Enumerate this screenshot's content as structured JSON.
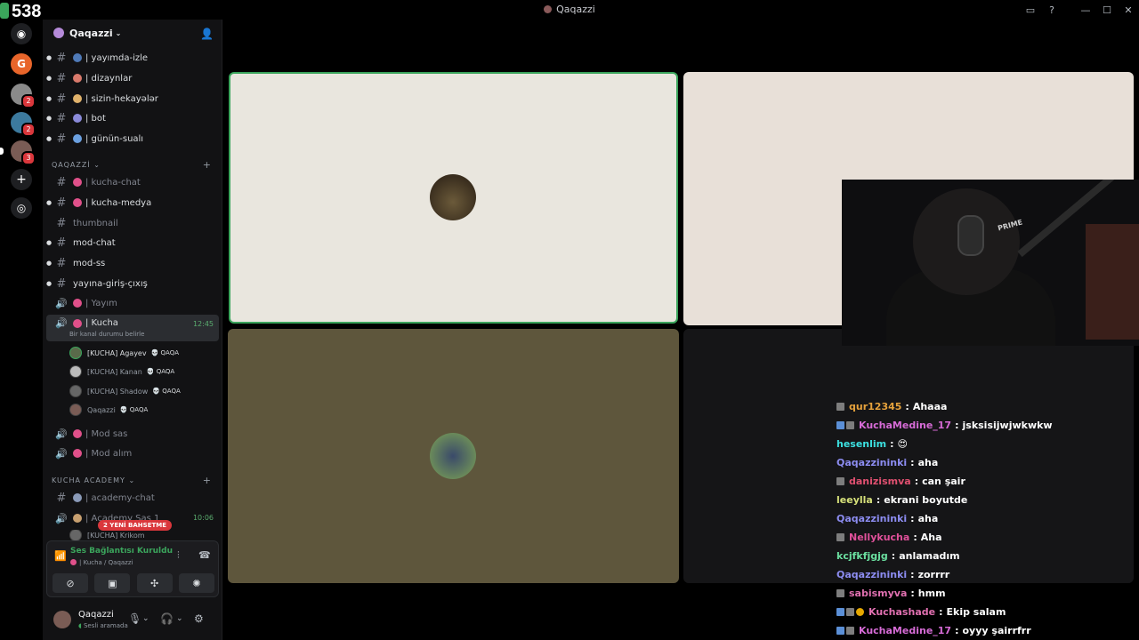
{
  "window": {
    "title": "Qaqazzi",
    "counter": "538"
  },
  "server": {
    "name": "Qaqazzi"
  },
  "channels": [
    {
      "id": "yayimda-izle",
      "label": "| yayımda-izle",
      "emoji_color": "#4f7ab8"
    },
    {
      "id": "dizaynlar",
      "label": "| dizaynlar",
      "emoji_color": "#d97a6c"
    },
    {
      "id": "sizin-hekayeler",
      "label": "| sizin-hekayələr",
      "emoji_color": "#e0b26b"
    },
    {
      "id": "bot",
      "label": "| bot",
      "emoji_color": "#8a8ad9"
    },
    {
      "id": "gunun-suali",
      "label": "| günün-sualı",
      "emoji_color": "#6ba0e0"
    }
  ],
  "category1": {
    "label": "QAQAZZİ"
  },
  "channels2": [
    {
      "id": "kucha-chat",
      "label": "| kucha-chat",
      "muted": true
    },
    {
      "id": "kucha-medya",
      "label": "| kucha-medya",
      "muted": false
    },
    {
      "id": "thumbnail",
      "label": "thumbnail",
      "muted": true
    },
    {
      "id": "mod-chat",
      "label": "mod-chat",
      "muted": false
    },
    {
      "id": "mod-ss",
      "label": "mod-ss",
      "muted": false
    },
    {
      "id": "yayina-giris-cixis",
      "label": "yayına-giriş-çıxış",
      "muted": false
    }
  ],
  "voice": {
    "yayim": "| Yayım",
    "kucha": {
      "label": "| Kucha",
      "time": "12:45",
      "status": "Bir kanal durumu belirle"
    },
    "users": [
      {
        "name": "[KUCHA] Agayev",
        "tag": "QAQA",
        "dim": false
      },
      {
        "name": "[KUCHA] Kanan",
        "tag": "QAQA",
        "dim": true
      },
      {
        "name": "[KUCHA] Shadow",
        "tag": "QAQA",
        "dim": true
      },
      {
        "name": "Qaqazzi",
        "tag": "QAQA",
        "dim": true
      }
    ],
    "mod_sas": "| Mod sas",
    "mod_alim": "| Mod alım"
  },
  "category2": {
    "label": "KUCHA ACADEMY"
  },
  "academy": {
    "chat": "| academy-chat",
    "sas": "| Academy Sas 1",
    "sas_time": "10:06",
    "partial_user": "[KUCHA] Krikom"
  },
  "mention_badge": "2 YENİ BAHSETME",
  "voice_panel": {
    "status": "Ses Bağlantısı Kuruldu",
    "location": "| Kucha / Qaqazzi"
  },
  "user": {
    "name": "Qaqazzi",
    "status": "Sesli aramada"
  },
  "colors": {
    "tile1": "#e9e6de",
    "tile2": "#e8e0d8",
    "tile3": "#5e563c",
    "tile4": "#151517",
    "speaking_border": "#3ba55c",
    "online_green": "#3ba55c"
  },
  "chat": [
    {
      "user": "qur12345",
      "color": "#e6a23c",
      "text": "Ahaaa",
      "badges": [
        "gray"
      ]
    },
    {
      "user": "KuchaMedine_17",
      "color": "#d66bd6",
      "text": "jsksisijwjwkwkw",
      "badges": [
        "blue",
        "gray"
      ]
    },
    {
      "user": "hesenlim",
      "color": "#3ce0e0",
      "text": "😍",
      "badges": []
    },
    {
      "user": "Qaqazzininki",
      "color": "#8c8cf0",
      "text": "aha",
      "badges": []
    },
    {
      "user": "danizismva",
      "color": "#e05070",
      "text": "can şair",
      "badges": [
        "gray"
      ]
    },
    {
      "user": "leeylla",
      "color": "#d6e07a",
      "text": "ekrani boyutde",
      "badges": []
    },
    {
      "user": "Qaqazzininki",
      "color": "#8c8cf0",
      "text": "aha",
      "badges": []
    },
    {
      "user": "Nellykucha",
      "color": "#e0509a",
      "text": "Aha",
      "badges": [
        "gray"
      ]
    },
    {
      "user": "kcjfkfjgjg",
      "color": "#6be0a0",
      "text": "anlamadım",
      "badges": []
    },
    {
      "user": "Qaqazzininki",
      "color": "#8c8cf0",
      "text": "zorrrr",
      "badges": []
    },
    {
      "user": "sabismyva",
      "color": "#e070b0",
      "text": "hmm",
      "badges": [
        "gray"
      ]
    },
    {
      "user": "Kuchashade",
      "color": "#e070b0",
      "text": "Ekip salam",
      "badges": [
        "blue",
        "gray",
        "gold"
      ]
    },
    {
      "user": "KuchaMedine_17",
      "color": "#d66bd6",
      "text": "oyyy şairrfrr",
      "badges": [
        "blue",
        "gray"
      ]
    }
  ]
}
